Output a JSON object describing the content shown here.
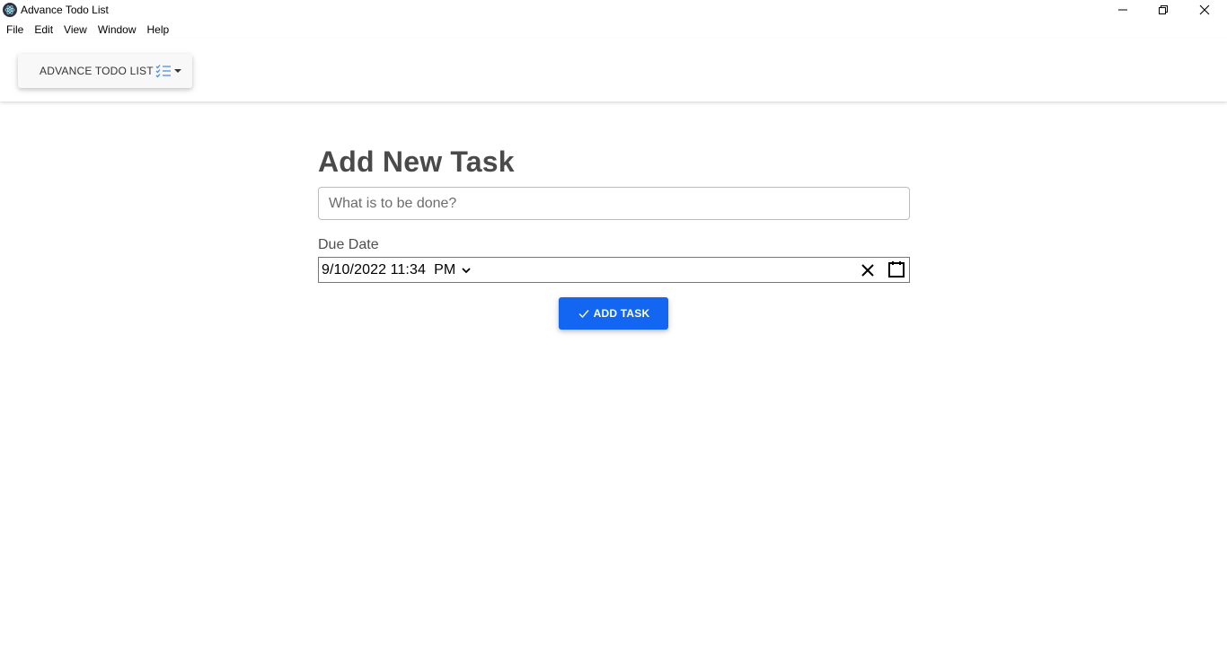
{
  "window": {
    "title": "Advance Todo List"
  },
  "menu": {
    "items": [
      "File",
      "Edit",
      "View",
      "Window",
      "Help"
    ]
  },
  "navbar": {
    "brand_label": "ADVANCE TODO LIST",
    "brand_icon": "checklist-icon",
    "dropdown_icon": "caret-down-icon"
  },
  "form": {
    "title": "Add New Task",
    "task_placeholder": "What is to be done?",
    "task_value": "",
    "due_label": "Due Date",
    "due_value": "9/10/2022 11:34  PM",
    "add_button_label": "ADD TASK"
  },
  "colors": {
    "accent": "#1266f1",
    "title_text": "#4a4a4a",
    "checklist_icon": "#4a90e2"
  }
}
